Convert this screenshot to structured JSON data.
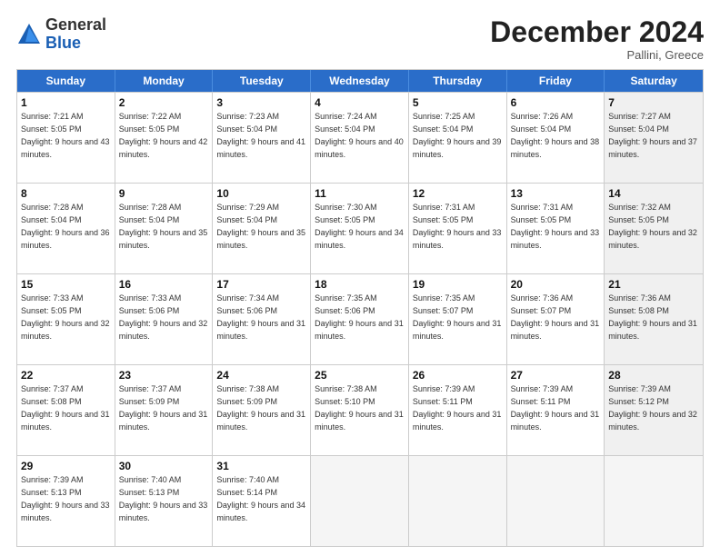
{
  "logo": {
    "line1": "General",
    "line2": "Blue"
  },
  "title": "December 2024",
  "subtitle": "Pallini, Greece",
  "header_days": [
    "Sunday",
    "Monday",
    "Tuesday",
    "Wednesday",
    "Thursday",
    "Friday",
    "Saturday"
  ],
  "weeks": [
    [
      {
        "day": "1",
        "sunrise": "Sunrise: 7:21 AM",
        "sunset": "Sunset: 5:05 PM",
        "daylight": "Daylight: 9 hours and 43 minutes."
      },
      {
        "day": "2",
        "sunrise": "Sunrise: 7:22 AM",
        "sunset": "Sunset: 5:05 PM",
        "daylight": "Daylight: 9 hours and 42 minutes."
      },
      {
        "day": "3",
        "sunrise": "Sunrise: 7:23 AM",
        "sunset": "Sunset: 5:04 PM",
        "daylight": "Daylight: 9 hours and 41 minutes."
      },
      {
        "day": "4",
        "sunrise": "Sunrise: 7:24 AM",
        "sunset": "Sunset: 5:04 PM",
        "daylight": "Daylight: 9 hours and 40 minutes."
      },
      {
        "day": "5",
        "sunrise": "Sunrise: 7:25 AM",
        "sunset": "Sunset: 5:04 PM",
        "daylight": "Daylight: 9 hours and 39 minutes."
      },
      {
        "day": "6",
        "sunrise": "Sunrise: 7:26 AM",
        "sunset": "Sunset: 5:04 PM",
        "daylight": "Daylight: 9 hours and 38 minutes."
      },
      {
        "day": "7",
        "sunrise": "Sunrise: 7:27 AM",
        "sunset": "Sunset: 5:04 PM",
        "daylight": "Daylight: 9 hours and 37 minutes.",
        "shaded": true
      }
    ],
    [
      {
        "day": "8",
        "sunrise": "Sunrise: 7:28 AM",
        "sunset": "Sunset: 5:04 PM",
        "daylight": "Daylight: 9 hours and 36 minutes."
      },
      {
        "day": "9",
        "sunrise": "Sunrise: 7:28 AM",
        "sunset": "Sunset: 5:04 PM",
        "daylight": "Daylight: 9 hours and 35 minutes."
      },
      {
        "day": "10",
        "sunrise": "Sunrise: 7:29 AM",
        "sunset": "Sunset: 5:04 PM",
        "daylight": "Daylight: 9 hours and 35 minutes."
      },
      {
        "day": "11",
        "sunrise": "Sunrise: 7:30 AM",
        "sunset": "Sunset: 5:05 PM",
        "daylight": "Daylight: 9 hours and 34 minutes."
      },
      {
        "day": "12",
        "sunrise": "Sunrise: 7:31 AM",
        "sunset": "Sunset: 5:05 PM",
        "daylight": "Daylight: 9 hours and 33 minutes."
      },
      {
        "day": "13",
        "sunrise": "Sunrise: 7:31 AM",
        "sunset": "Sunset: 5:05 PM",
        "daylight": "Daylight: 9 hours and 33 minutes."
      },
      {
        "day": "14",
        "sunrise": "Sunrise: 7:32 AM",
        "sunset": "Sunset: 5:05 PM",
        "daylight": "Daylight: 9 hours and 32 minutes.",
        "shaded": true
      }
    ],
    [
      {
        "day": "15",
        "sunrise": "Sunrise: 7:33 AM",
        "sunset": "Sunset: 5:05 PM",
        "daylight": "Daylight: 9 hours and 32 minutes."
      },
      {
        "day": "16",
        "sunrise": "Sunrise: 7:33 AM",
        "sunset": "Sunset: 5:06 PM",
        "daylight": "Daylight: 9 hours and 32 minutes."
      },
      {
        "day": "17",
        "sunrise": "Sunrise: 7:34 AM",
        "sunset": "Sunset: 5:06 PM",
        "daylight": "Daylight: 9 hours and 31 minutes."
      },
      {
        "day": "18",
        "sunrise": "Sunrise: 7:35 AM",
        "sunset": "Sunset: 5:06 PM",
        "daylight": "Daylight: 9 hours and 31 minutes."
      },
      {
        "day": "19",
        "sunrise": "Sunrise: 7:35 AM",
        "sunset": "Sunset: 5:07 PM",
        "daylight": "Daylight: 9 hours and 31 minutes."
      },
      {
        "day": "20",
        "sunrise": "Sunrise: 7:36 AM",
        "sunset": "Sunset: 5:07 PM",
        "daylight": "Daylight: 9 hours and 31 minutes."
      },
      {
        "day": "21",
        "sunrise": "Sunrise: 7:36 AM",
        "sunset": "Sunset: 5:08 PM",
        "daylight": "Daylight: 9 hours and 31 minutes.",
        "shaded": true
      }
    ],
    [
      {
        "day": "22",
        "sunrise": "Sunrise: 7:37 AM",
        "sunset": "Sunset: 5:08 PM",
        "daylight": "Daylight: 9 hours and 31 minutes."
      },
      {
        "day": "23",
        "sunrise": "Sunrise: 7:37 AM",
        "sunset": "Sunset: 5:09 PM",
        "daylight": "Daylight: 9 hours and 31 minutes."
      },
      {
        "day": "24",
        "sunrise": "Sunrise: 7:38 AM",
        "sunset": "Sunset: 5:09 PM",
        "daylight": "Daylight: 9 hours and 31 minutes."
      },
      {
        "day": "25",
        "sunrise": "Sunrise: 7:38 AM",
        "sunset": "Sunset: 5:10 PM",
        "daylight": "Daylight: 9 hours and 31 minutes."
      },
      {
        "day": "26",
        "sunrise": "Sunrise: 7:39 AM",
        "sunset": "Sunset: 5:11 PM",
        "daylight": "Daylight: 9 hours and 31 minutes."
      },
      {
        "day": "27",
        "sunrise": "Sunrise: 7:39 AM",
        "sunset": "Sunset: 5:11 PM",
        "daylight": "Daylight: 9 hours and 31 minutes."
      },
      {
        "day": "28",
        "sunrise": "Sunrise: 7:39 AM",
        "sunset": "Sunset: 5:12 PM",
        "daylight": "Daylight: 9 hours and 32 minutes.",
        "shaded": true
      }
    ],
    [
      {
        "day": "29",
        "sunrise": "Sunrise: 7:39 AM",
        "sunset": "Sunset: 5:13 PM",
        "daylight": "Daylight: 9 hours and 33 minutes."
      },
      {
        "day": "30",
        "sunrise": "Sunrise: 7:40 AM",
        "sunset": "Sunset: 5:13 PM",
        "daylight": "Daylight: 9 hours and 33 minutes."
      },
      {
        "day": "31",
        "sunrise": "Sunrise: 7:40 AM",
        "sunset": "Sunset: 5:14 PM",
        "daylight": "Daylight: 9 hours and 34 minutes."
      },
      {
        "day": "",
        "empty": true
      },
      {
        "day": "",
        "empty": true
      },
      {
        "day": "",
        "empty": true
      },
      {
        "day": "",
        "empty": true,
        "shaded": true
      }
    ]
  ]
}
